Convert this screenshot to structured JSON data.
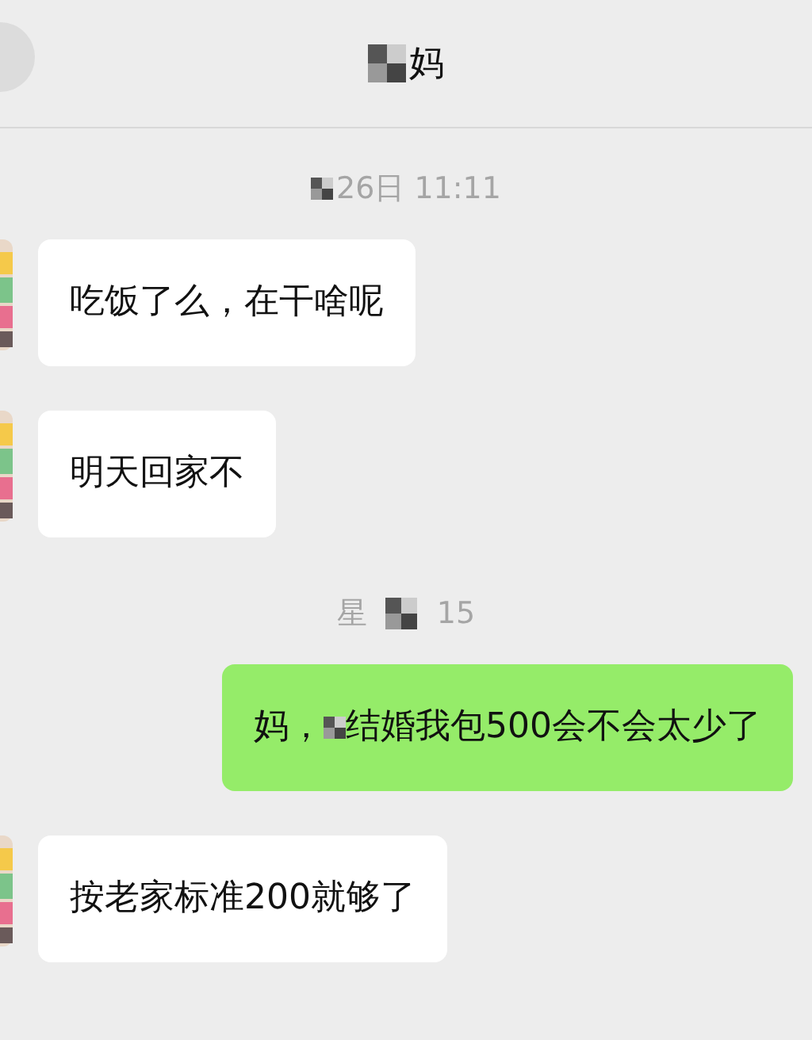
{
  "header": {
    "title_visible": "妈"
  },
  "messages": [
    {
      "kind": "time",
      "after": "26日 11:11"
    },
    {
      "kind": "in",
      "text": "吃饭了么，在干啥呢"
    },
    {
      "kind": "in",
      "text": "明天回家不"
    },
    {
      "kind": "time",
      "before": "星",
      "after": "15"
    },
    {
      "kind": "out",
      "before": "妈，",
      "after": "结婚我包500会不会太少了"
    },
    {
      "kind": "in",
      "text": "按老家标准200就够了"
    }
  ]
}
